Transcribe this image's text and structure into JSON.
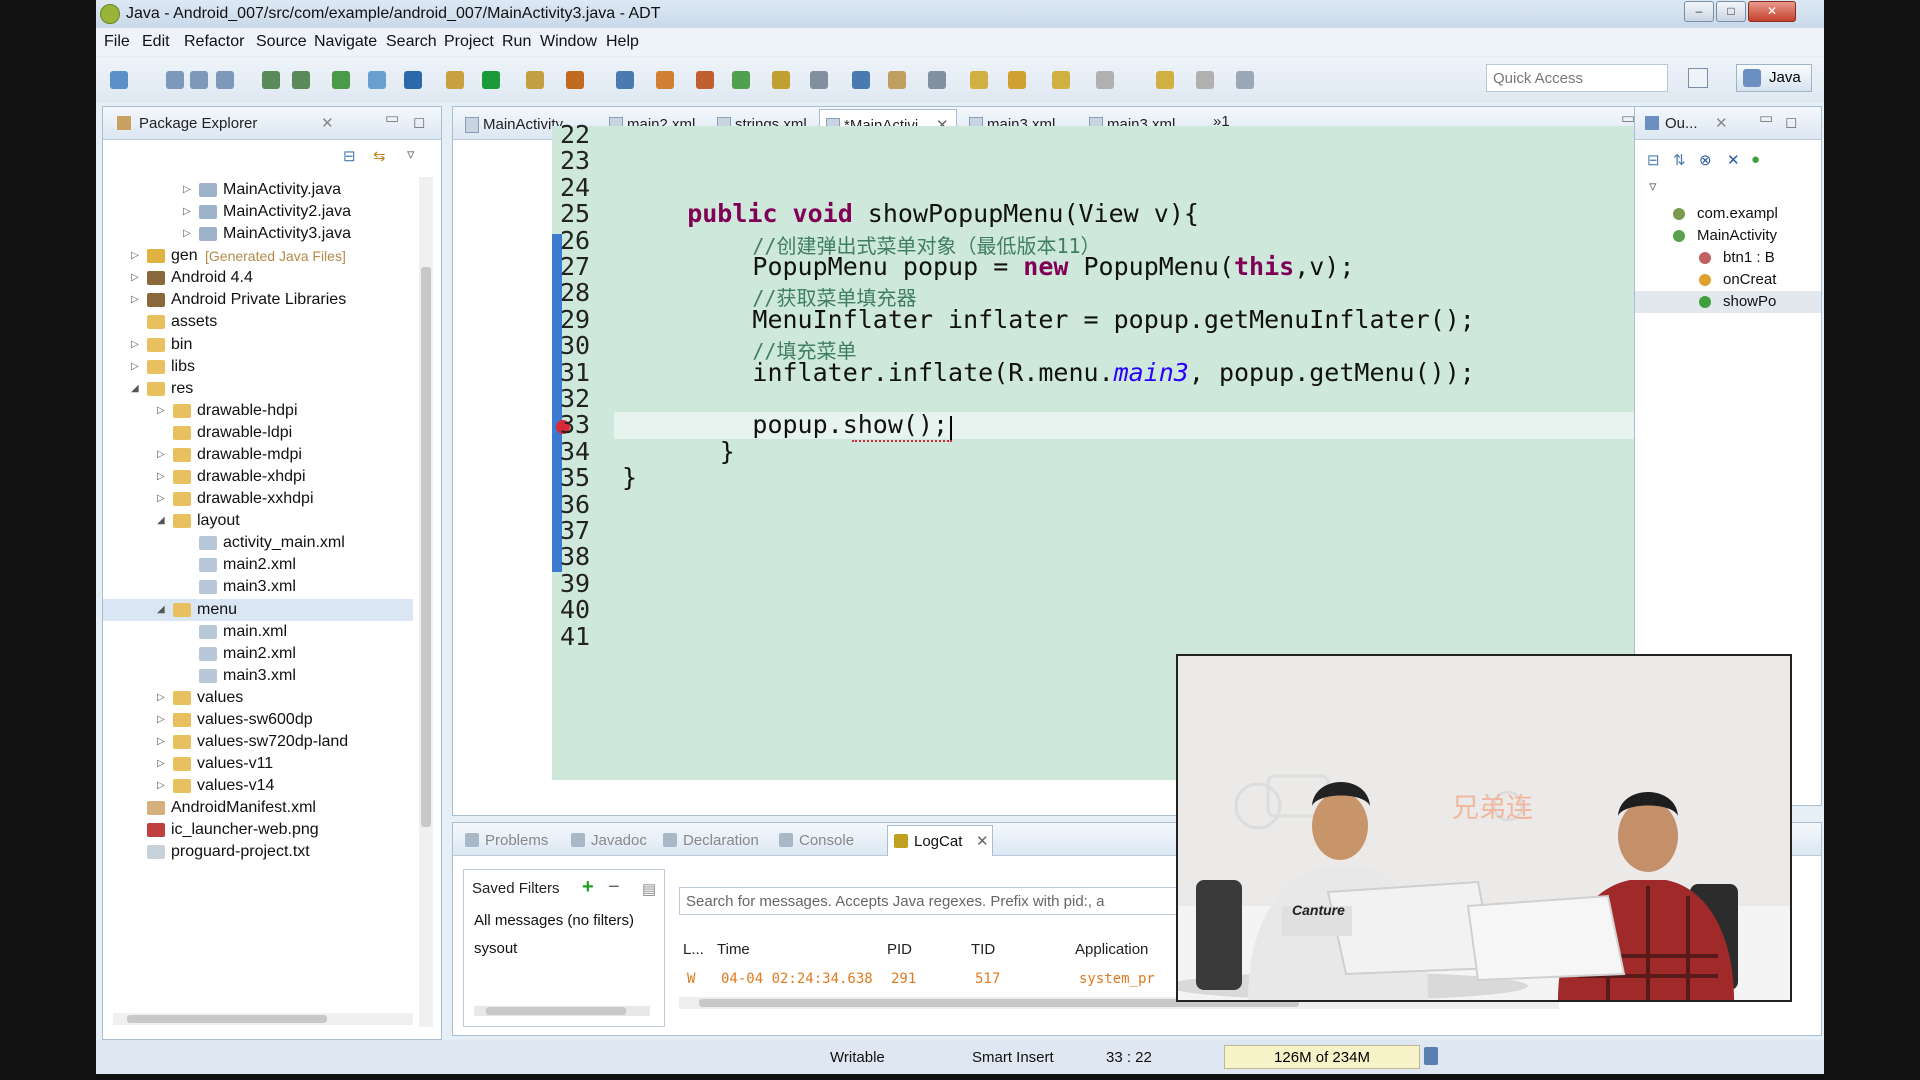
{
  "window": {
    "title": "Java - Android_007/src/com/example/android_007/MainActivity3.java - ADT",
    "min": "–",
    "max": "□",
    "close": "✕"
  },
  "menu": [
    "File",
    "Edit",
    "Refactor",
    "Source",
    "Navigate",
    "Search",
    "Project",
    "Run",
    "Window",
    "Help"
  ],
  "toolbar": {
    "quick_access_placeholder": "Quick Access",
    "perspective": "Java"
  },
  "explorer": {
    "tab": "Package Explorer",
    "tree": [
      {
        "label": "MainActivity.java",
        "depth": 3,
        "arrow": "▷",
        "icon": "java-file-icon",
        "color": "#9db3cc"
      },
      {
        "label": "MainActivity2.java",
        "depth": 3,
        "arrow": "▷",
        "icon": "java-file-icon",
        "color": "#9db3cc"
      },
      {
        "label": "MainActivity3.java",
        "depth": 3,
        "arrow": "▷",
        "icon": "java-file-icon",
        "color": "#9db3cc"
      },
      {
        "label": "gen",
        "extra": "[Generated Java Files]",
        "depth": 1,
        "arrow": "▷",
        "icon": "gen-folder-icon",
        "color": "#e0b040"
      },
      {
        "label": "Android 4.4",
        "depth": 1,
        "arrow": "▷",
        "icon": "library-icon",
        "color": "#8a6a3a"
      },
      {
        "label": "Android Private Libraries",
        "depth": 1,
        "arrow": "▷",
        "icon": "library-icon",
        "color": "#8a6a3a"
      },
      {
        "label": "assets",
        "depth": 1,
        "arrow": "",
        "icon": "folder-icon",
        "color": "#e8c060"
      },
      {
        "label": "bin",
        "depth": 1,
        "arrow": "▷",
        "icon": "folder-icon",
        "color": "#e8c060"
      },
      {
        "label": "libs",
        "depth": 1,
        "arrow": "▷",
        "icon": "folder-icon",
        "color": "#e8c060"
      },
      {
        "label": "res",
        "depth": 1,
        "arrow": "◢",
        "icon": "folder-icon",
        "color": "#e8c060"
      },
      {
        "label": "drawable-hdpi",
        "depth": 2,
        "arrow": "▷",
        "icon": "folder-icon",
        "color": "#e8c060"
      },
      {
        "label": "drawable-ldpi",
        "depth": 2,
        "arrow": "",
        "icon": "folder-icon",
        "color": "#e8c060"
      },
      {
        "label": "drawable-mdpi",
        "depth": 2,
        "arrow": "▷",
        "icon": "folder-icon",
        "color": "#e8c060"
      },
      {
        "label": "drawable-xhdpi",
        "depth": 2,
        "arrow": "▷",
        "icon": "folder-icon",
        "color": "#e8c060"
      },
      {
        "label": "drawable-xxhdpi",
        "depth": 2,
        "arrow": "▷",
        "icon": "folder-icon",
        "color": "#e8c060"
      },
      {
        "label": "layout",
        "depth": 2,
        "arrow": "◢",
        "icon": "folder-icon",
        "color": "#e8c060"
      },
      {
        "label": "activity_main.xml",
        "depth": 3,
        "arrow": "",
        "icon": "xml-file-icon",
        "color": "#b7c8d8"
      },
      {
        "label": "main2.xml",
        "depth": 3,
        "arrow": "",
        "icon": "xml-file-icon",
        "color": "#b7c8d8"
      },
      {
        "label": "main3.xml",
        "depth": 3,
        "arrow": "",
        "icon": "xml-file-icon",
        "color": "#b7c8d8"
      },
      {
        "label": "menu",
        "depth": 2,
        "arrow": "◢",
        "icon": "folder-icon",
        "color": "#e8c060",
        "selected": true
      },
      {
        "label": "main.xml",
        "depth": 3,
        "arrow": "",
        "icon": "xml-file-icon",
        "color": "#b7c8d8"
      },
      {
        "label": "main2.xml",
        "depth": 3,
        "arrow": "",
        "icon": "xml-file-icon",
        "color": "#b7c8d8"
      },
      {
        "label": "main3.xml",
        "depth": 3,
        "arrow": "",
        "icon": "xml-file-icon",
        "color": "#b7c8d8"
      },
      {
        "label": "values",
        "depth": 2,
        "arrow": "▷",
        "icon": "folder-icon",
        "color": "#e8c060"
      },
      {
        "label": "values-sw600dp",
        "depth": 2,
        "arrow": "▷",
        "icon": "folder-icon",
        "color": "#e8c060"
      },
      {
        "label": "values-sw720dp-land",
        "depth": 2,
        "arrow": "▷",
        "icon": "folder-icon",
        "color": "#e8c060"
      },
      {
        "label": "values-v11",
        "depth": 2,
        "arrow": "▷",
        "icon": "folder-icon",
        "color": "#e8c060"
      },
      {
        "label": "values-v14",
        "depth": 2,
        "arrow": "▷",
        "icon": "folder-icon",
        "color": "#e8c060"
      },
      {
        "label": "AndroidManifest.xml",
        "depth": 1,
        "arrow": "",
        "icon": "manifest-file-icon",
        "color": "#d6b07a"
      },
      {
        "label": "ic_launcher-web.png",
        "depth": 1,
        "arrow": "",
        "icon": "image-file-icon",
        "color": "#c04040"
      },
      {
        "label": "proguard-project.txt",
        "depth": 1,
        "arrow": "",
        "icon": "text-file-icon",
        "color": "#c8d2dc"
      }
    ]
  },
  "editor": {
    "tabs": [
      {
        "label": "MainActivity...",
        "icon": "java-file-icon",
        "active": false
      },
      {
        "label": "main2.xml",
        "icon": "xml-file-icon",
        "active": false
      },
      {
        "label": "strings.xml",
        "icon": "xml-file-icon",
        "active": false
      },
      {
        "label": "*MainActivi...",
        "icon": "java-file-icon",
        "active": true
      },
      {
        "label": "main3.xml",
        "icon": "xml-file-icon",
        "active": false
      },
      {
        "label": "main3.xml",
        "icon": "xml-file-icon",
        "active": false
      }
    ],
    "tabs_overflow": "»1",
    "lines": [
      {
        "num": "22",
        "code": []
      },
      {
        "num": "23",
        "code": []
      },
      {
        "num": "24",
        "code": []
      },
      {
        "num": "25",
        "indent": 2,
        "code": [
          {
            "k": "kw",
            "t": "public "
          },
          {
            "k": "kw",
            "t": "void "
          },
          {
            "k": "",
            "t": "showPopupMenu(View v){"
          }
        ]
      },
      {
        "num": "26",
        "indent": 4,
        "code": [
          {
            "k": "cm",
            "t": "//创建弹出式菜单对象（最低版本11）"
          }
        ]
      },
      {
        "num": "27",
        "indent": 4,
        "code": [
          {
            "k": "",
            "t": "PopupMenu popup = "
          },
          {
            "k": "kw",
            "t": "new "
          },
          {
            "k": "",
            "t": "PopupMenu("
          },
          {
            "k": "kw",
            "t": "this"
          },
          {
            "k": "",
            "t": ",v);"
          }
        ]
      },
      {
        "num": "28",
        "indent": 4,
        "code": [
          {
            "k": "cm",
            "t": "//获取菜单填充器"
          }
        ]
      },
      {
        "num": "29",
        "indent": 4,
        "code": [
          {
            "k": "",
            "t": "MenuInflater inflater = popup.getMenuInflater();"
          }
        ]
      },
      {
        "num": "30",
        "indent": 4,
        "code": [
          {
            "k": "cm",
            "t": "//填充菜单"
          }
        ]
      },
      {
        "num": "31",
        "indent": 4,
        "code": [
          {
            "k": "",
            "t": "inflater.inflate(R.menu."
          },
          {
            "k": "it",
            "t": "main3"
          },
          {
            "k": "",
            "t": ", popup.getMenu());"
          }
        ]
      },
      {
        "num": "32",
        "code": []
      },
      {
        "num": "33",
        "indent": 4,
        "error": true,
        "current": true,
        "code": [
          {
            "k": "",
            "t": "popup.show();"
          }
        ]
      },
      {
        "num": "34",
        "indent": 3,
        "code": [
          {
            "k": "",
            "t": "}"
          }
        ]
      },
      {
        "num": "35",
        "indent": 0,
        "code": [
          {
            "k": "",
            "t": "}"
          }
        ]
      },
      {
        "num": "36",
        "code": []
      },
      {
        "num": "37",
        "code": []
      },
      {
        "num": "38",
        "code": []
      },
      {
        "num": "39",
        "code": []
      },
      {
        "num": "40",
        "code": []
      },
      {
        "num": "41",
        "code": []
      }
    ]
  },
  "outline": {
    "tab": "Ou...",
    "items": [
      {
        "label": "com.exampl",
        "icon": "import-icon",
        "color": "#7a9a50"
      },
      {
        "label": "MainActivity",
        "icon": "class-icon",
        "color": "#5aa050"
      },
      {
        "label": "btn1 : B",
        "icon": "field-icon",
        "color": "#c06060"
      },
      {
        "label": "onCreat",
        "icon": "method-icon",
        "color": "#e0a030"
      },
      {
        "label": "showPo",
        "icon": "method-icon",
        "color": "#40a040"
      }
    ]
  },
  "bottom": {
    "tabs": [
      {
        "label": "Problems",
        "icon": "problems-icon",
        "active": false
      },
      {
        "label": "Javadoc",
        "icon": "javadoc-icon",
        "active": false
      },
      {
        "label": "Declaration",
        "icon": "declaration-icon",
        "active": false
      },
      {
        "label": "Console",
        "icon": "console-icon",
        "active": false
      },
      {
        "label": "LogCat",
        "icon": "logcat-icon",
        "active": true
      }
    ],
    "saved_filters": "Saved Filters",
    "filters": [
      "All messages (no filters)",
      "sysout"
    ],
    "search_placeholder": "Search for messages. Accepts Java regexes. Prefix with pid:, a",
    "columns": [
      "L...",
      "Time",
      "PID",
      "TID",
      "Application"
    ],
    "rows": [
      {
        "level": "W",
        "time": "04-04 02:24:34.638",
        "pid": "291",
        "tid": "517",
        "app": "system_pr"
      }
    ]
  },
  "status": {
    "mode": "Writable",
    "insert": "Smart Insert",
    "position": "33 : 22",
    "memory": "126M of 234M"
  },
  "video": {
    "watermark": "兄弟连",
    "shirt_text": "Canture"
  }
}
